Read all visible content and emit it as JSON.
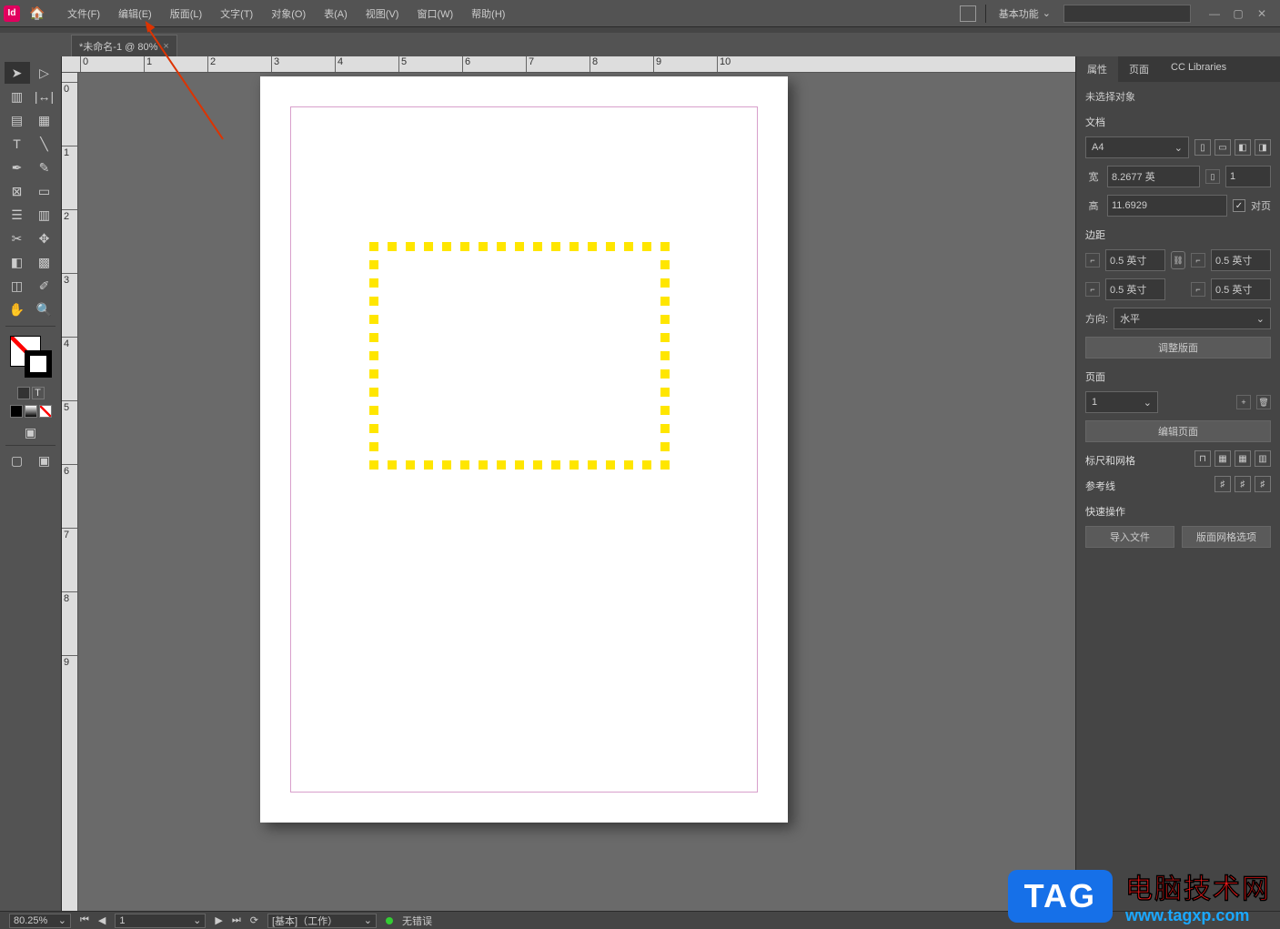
{
  "app": {
    "id_badge": "Id"
  },
  "menu": {
    "file": "文件(F)",
    "edit": "编辑(E)",
    "layout": "版面(L)",
    "type": "文字(T)",
    "object": "对象(O)",
    "table": "表(A)",
    "view": "视图(V)",
    "window": "窗口(W)",
    "help": "帮助(H)"
  },
  "title_right": {
    "workspace": "基本功能",
    "caret": "⌄"
  },
  "doc_tab": {
    "name": "*未命名-1 @ 80%",
    "close": "×"
  },
  "ruler_h": [
    "0",
    "1",
    "2",
    "3",
    "4",
    "5",
    "6",
    "7",
    "8",
    "9",
    "10"
  ],
  "ruler_v": [
    "0",
    "1",
    "2",
    "3",
    "4",
    "5",
    "6",
    "7",
    "8",
    "9"
  ],
  "panel_tabs": {
    "t1": "属性",
    "t2": "页面",
    "t3": "CC Libraries"
  },
  "props": {
    "no_selection": "未选择对象",
    "sec_document": "文档",
    "page_size": "A4",
    "width_label": "宽",
    "width_value": "8.2677 英",
    "height_label": "高",
    "height_value": "11.6929",
    "pages_count": "1",
    "facing_label": "对页",
    "sec_margins": "边距",
    "m_top": "0.5 英寸",
    "m_bottom": "0.5 英寸",
    "m_left": "0.5 英寸",
    "m_right": "0.5 英寸",
    "orientation_label": "方向:",
    "orientation_value": "水平",
    "adjust_layout": "调整版面",
    "sec_pages": "页面",
    "page_dd": "1",
    "edit_pages": "编辑页面",
    "sec_rulers": "标尺和网格",
    "sec_guides": "参考线",
    "sec_quick": "快速操作",
    "import_file": "导入文件",
    "grid_options": "版面网格选项"
  },
  "status": {
    "zoom": "80.25%",
    "page": "1",
    "preset": "[基本]（工作）",
    "no_errors": "无错误"
  },
  "watermark": {
    "tag": "TAG",
    "cn": "电脑技术网",
    "url": "www.tagxp.com"
  },
  "colors": {
    "accent_yellow": "#ffe600"
  }
}
